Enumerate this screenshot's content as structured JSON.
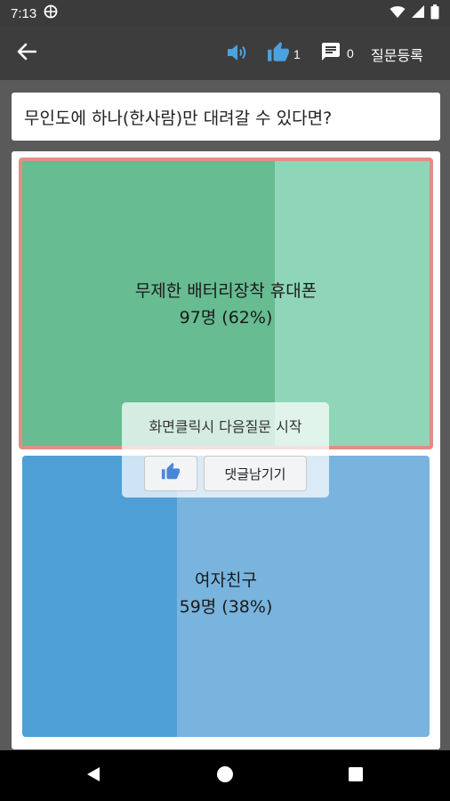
{
  "status_bar": {
    "time": "7:13"
  },
  "app_bar": {
    "like_count": "1",
    "comment_count": "0",
    "register_label": "질문등록"
  },
  "question": {
    "text": "무인도에 하나(한사람)만 대려갈 수 있다면?"
  },
  "options": [
    {
      "label": "무제한 배터리장착 휴대폰",
      "result": "97명 (62%)",
      "votes": 97,
      "percent": 62,
      "selected": true,
      "color": "#67bc92",
      "bg_color": "#8fd6b8"
    },
    {
      "label": "여자친구",
      "result": "59명 (38%)",
      "votes": 59,
      "percent": 38,
      "selected": false,
      "color": "#4e9fd6",
      "bg_color": "#79b4df"
    }
  ],
  "overlay": {
    "hint": "화면클릭시 다음질문 시작",
    "comment_label": "댓글남기기"
  },
  "colors": {
    "accent": "#4aa3df",
    "highlight_border": "#e38e84"
  }
}
